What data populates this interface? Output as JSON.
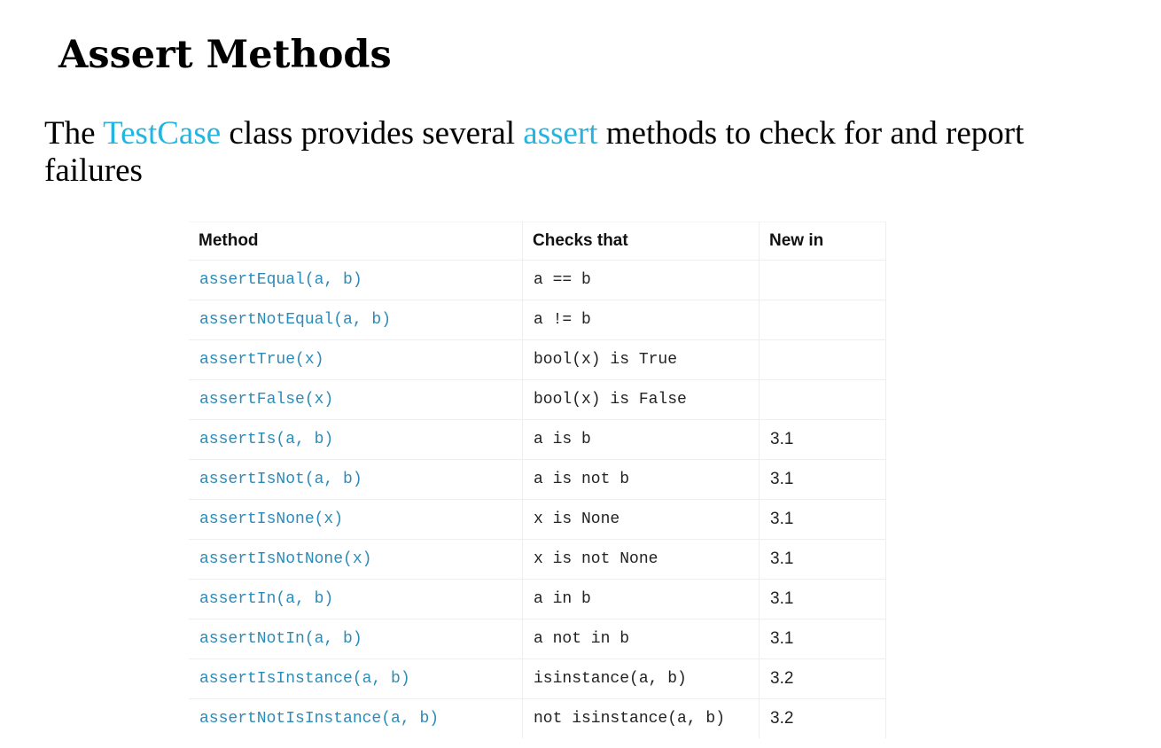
{
  "title": "Assert Methods",
  "intro": {
    "before": "The ",
    "link1": "TestCase",
    "middle": " class provides several ",
    "link2": "assert",
    "after": " methods to check for and report failures"
  },
  "table": {
    "headers": [
      "Method",
      "Checks that",
      "New in"
    ],
    "rows": [
      {
        "method": "assertEqual(a, b)",
        "checks": "a == b",
        "new_in": ""
      },
      {
        "method": "assertNotEqual(a, b)",
        "checks": "a != b",
        "new_in": ""
      },
      {
        "method": "assertTrue(x)",
        "checks": "bool(x) is True",
        "new_in": ""
      },
      {
        "method": "assertFalse(x)",
        "checks": "bool(x) is False",
        "new_in": ""
      },
      {
        "method": "assertIs(a, b)",
        "checks": "a is b",
        "new_in": "3.1"
      },
      {
        "method": "assertIsNot(a, b)",
        "checks": "a is not b",
        "new_in": "3.1"
      },
      {
        "method": "assertIsNone(x)",
        "checks": "x is None",
        "new_in": "3.1"
      },
      {
        "method": "assertIsNotNone(x)",
        "checks": "x is not None",
        "new_in": "3.1"
      },
      {
        "method": "assertIn(a, b)",
        "checks": "a in b",
        "new_in": "3.1"
      },
      {
        "method": "assertNotIn(a, b)",
        "checks": "a not in b",
        "new_in": "3.1"
      },
      {
        "method": "assertIsInstance(a, b)",
        "checks": "isinstance(a, b)",
        "new_in": "3.2"
      },
      {
        "method": "assertNotIsInstance(a, b)",
        "checks": "not isinstance(a, b)",
        "new_in": "3.2"
      }
    ]
  },
  "colors": {
    "link": "#23b5e0",
    "method_text": "#2c8bb8"
  }
}
